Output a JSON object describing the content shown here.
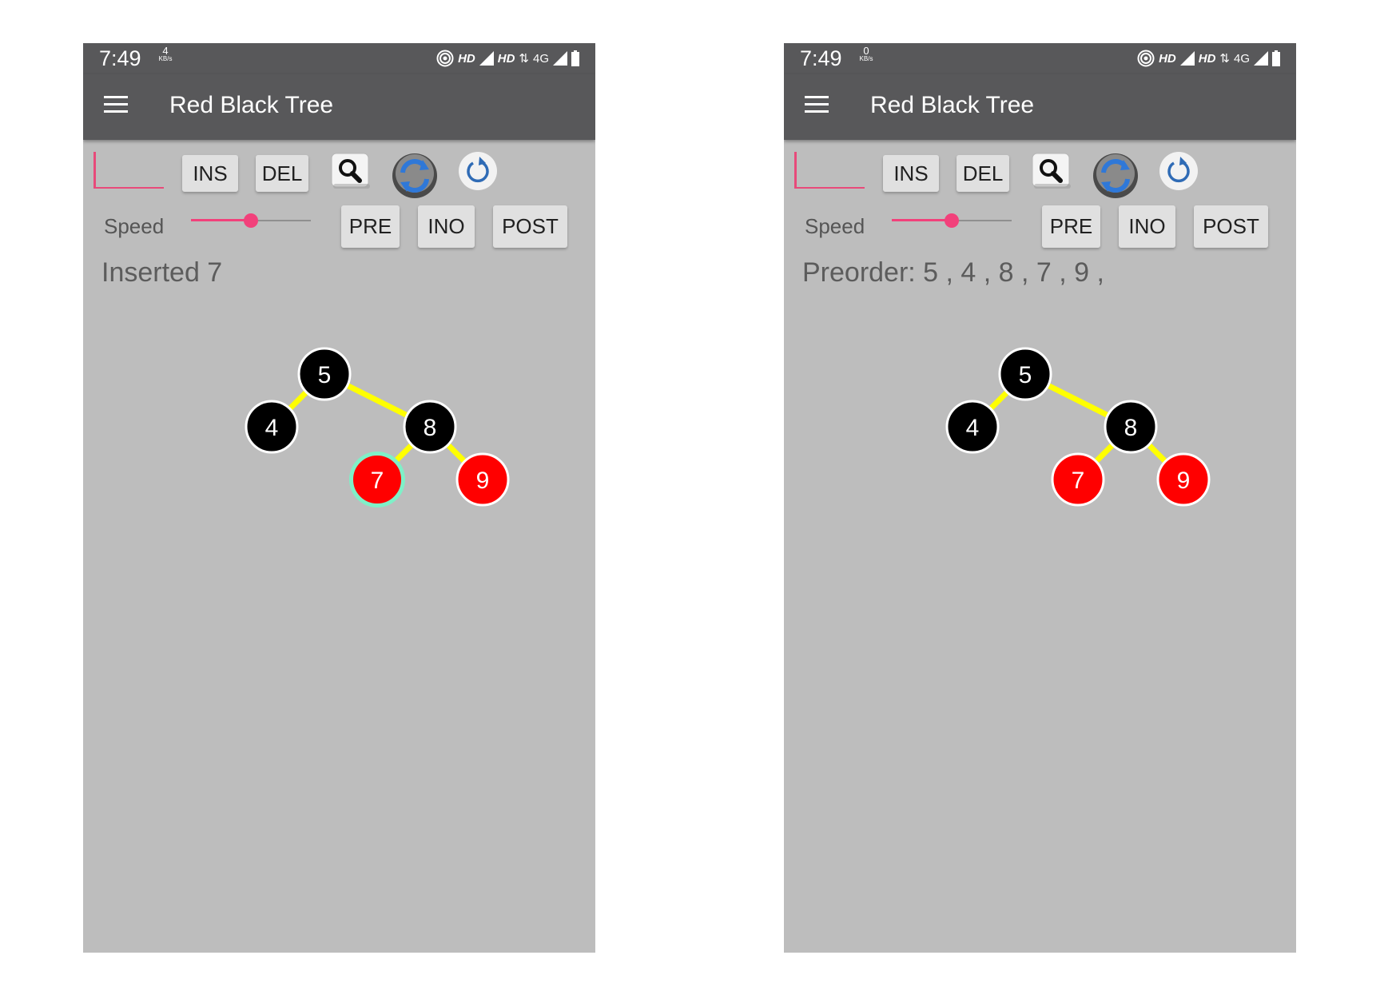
{
  "colors": {
    "app_bar": "#58585a",
    "canvas": "#bdbdbd",
    "accent": "#f2417b",
    "edge": "#ffff00",
    "black_node": "#000000",
    "red_node": "#ff0000",
    "highlight_ring": "#7ff0c8"
  },
  "screens": [
    {
      "status_bar": {
        "time": "7:49",
        "net_speed_value": "4",
        "net_speed_unit": "KB/s",
        "hd1": "HD",
        "hd2": "HD",
        "net_type": "4G"
      },
      "app_title": "Red Black Tree",
      "toolbar": {
        "ins_label": "INS",
        "del_label": "DEL",
        "search_icon": "search-icon",
        "refresh_icon": "refresh-icon",
        "reset_icon": "reset-icon"
      },
      "speed": {
        "label": "Speed",
        "level": 0.5
      },
      "traversal": {
        "pre_label": "PRE",
        "ino_label": "INO",
        "post_label": "POST"
      },
      "message": "Inserted 7",
      "tree": {
        "nodes": [
          {
            "id": "5",
            "label": "5",
            "color": "black",
            "highlighted": false
          },
          {
            "id": "4",
            "label": "4",
            "color": "black",
            "highlighted": false
          },
          {
            "id": "8",
            "label": "8",
            "color": "black",
            "highlighted": false
          },
          {
            "id": "7",
            "label": "7",
            "color": "red",
            "highlighted": true
          },
          {
            "id": "9",
            "label": "9",
            "color": "red",
            "highlighted": false
          }
        ],
        "edges": [
          [
            "5",
            "4"
          ],
          [
            "5",
            "8"
          ],
          [
            "8",
            "7"
          ],
          [
            "8",
            "9"
          ]
        ]
      }
    },
    {
      "status_bar": {
        "time": "7:49",
        "net_speed_value": "0",
        "net_speed_unit": "KB/s",
        "hd1": "HD",
        "hd2": "HD",
        "net_type": "4G"
      },
      "app_title": "Red Black Tree",
      "toolbar": {
        "ins_label": "INS",
        "del_label": "DEL",
        "search_icon": "search-icon",
        "refresh_icon": "refresh-icon",
        "reset_icon": "reset-icon"
      },
      "speed": {
        "label": "Speed",
        "level": 0.5
      },
      "traversal": {
        "pre_label": "PRE",
        "ino_label": "INO",
        "post_label": "POST"
      },
      "message": "Preorder: 5 , 4 , 8 , 7 , 9 ,",
      "tree": {
        "nodes": [
          {
            "id": "5",
            "label": "5",
            "color": "black",
            "highlighted": false
          },
          {
            "id": "4",
            "label": "4",
            "color": "black",
            "highlighted": false
          },
          {
            "id": "8",
            "label": "8",
            "color": "black",
            "highlighted": false
          },
          {
            "id": "7",
            "label": "7",
            "color": "red",
            "highlighted": false
          },
          {
            "id": "9",
            "label": "9",
            "color": "red",
            "highlighted": false
          }
        ],
        "edges": [
          [
            "5",
            "4"
          ],
          [
            "5",
            "8"
          ],
          [
            "8",
            "7"
          ],
          [
            "8",
            "9"
          ]
        ]
      }
    }
  ]
}
